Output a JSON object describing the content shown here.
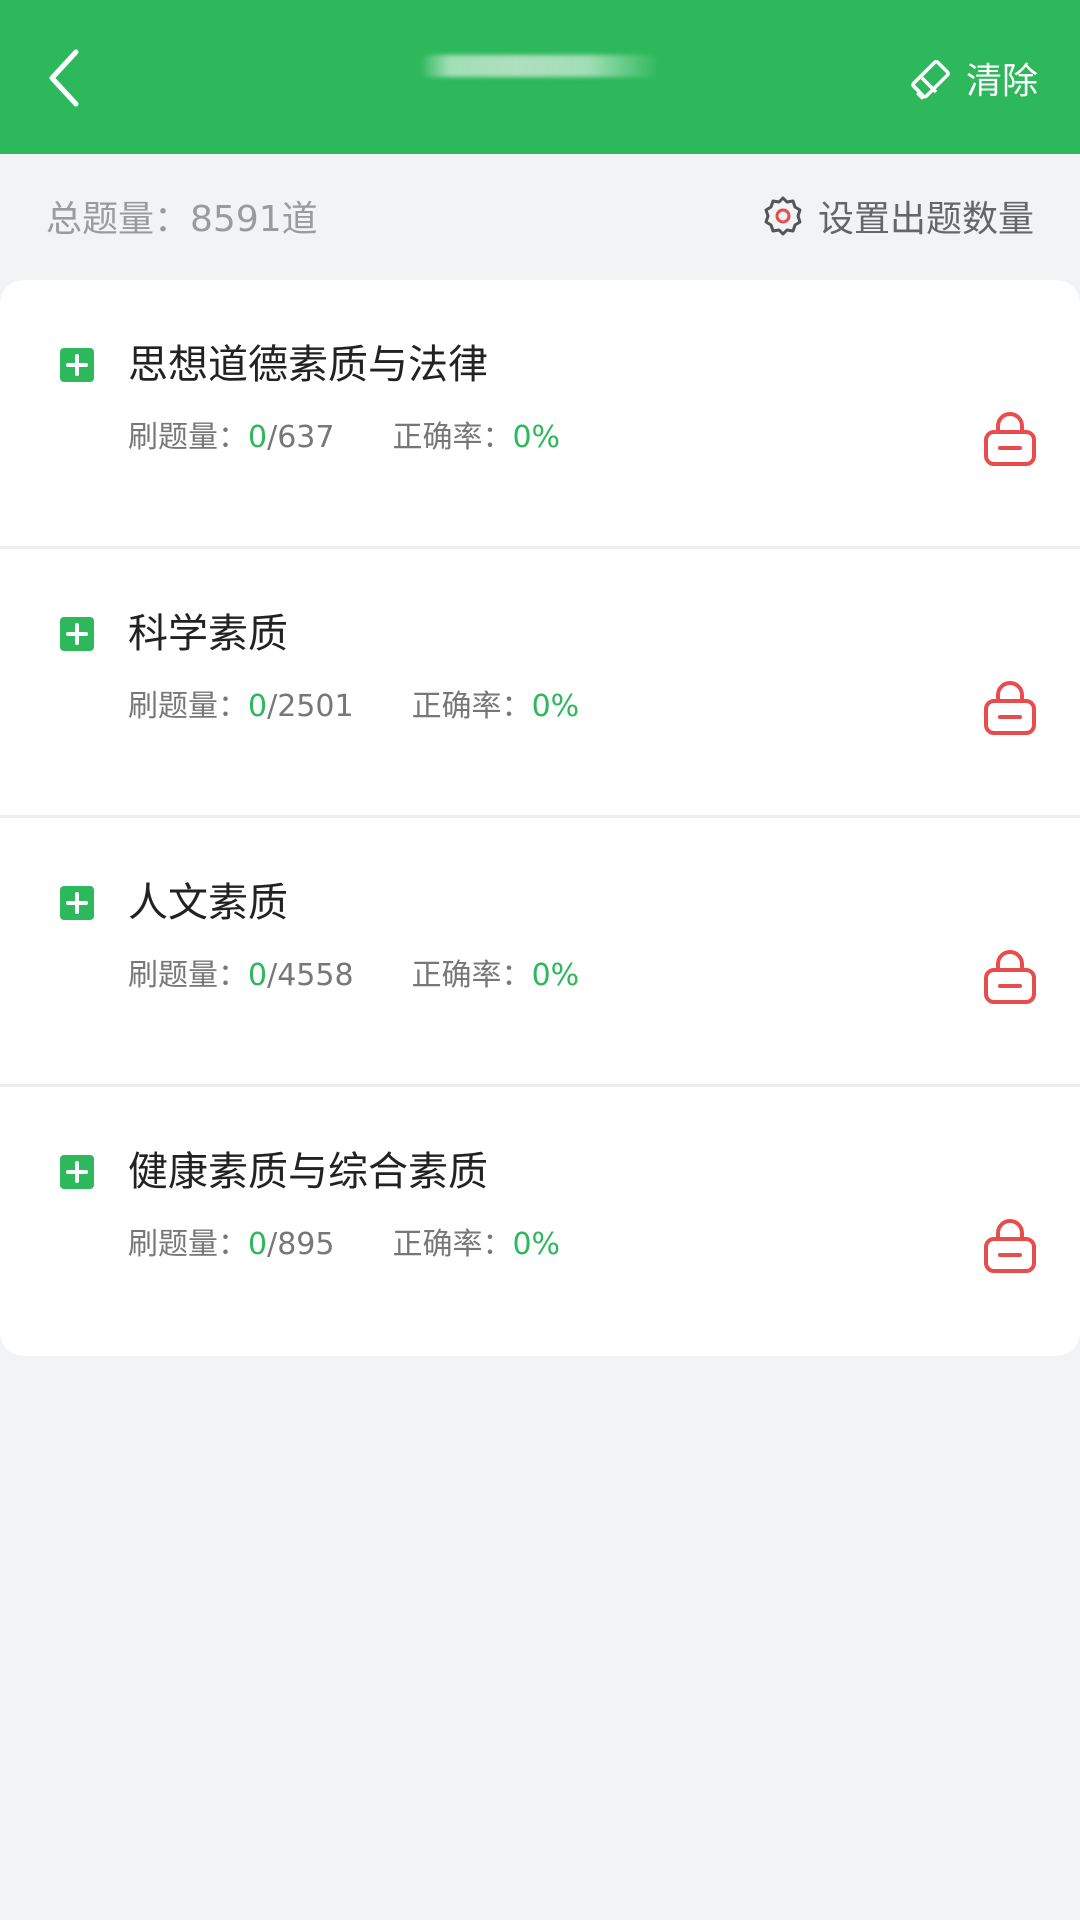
{
  "header": {
    "clear_label": "清除"
  },
  "summary": {
    "total_label": "总题量：",
    "total_value": "8591道",
    "set_count_label": "设置出题数量"
  },
  "subjects": [
    {
      "title": "思想道德素质与法律",
      "practice_label": "刷题量：",
      "done": "0",
      "total": "/637",
      "accuracy_label": "正确率：",
      "accuracy": "0%"
    },
    {
      "title": "科学素质",
      "practice_label": "刷题量：",
      "done": "0",
      "total": "/2501",
      "accuracy_label": "正确率：",
      "accuracy": "0%"
    },
    {
      "title": "人文素质",
      "practice_label": "刷题量：",
      "done": "0",
      "total": "/4558",
      "accuracy_label": "正确率：",
      "accuracy": "0%"
    },
    {
      "title": "健康素质与综合素质",
      "practice_label": "刷题量：",
      "done": "0",
      "total": "/895",
      "accuracy_label": "正确率：",
      "accuracy": "0%"
    }
  ],
  "colors": {
    "brand_green": "#2eb85c",
    "lock_red": "#e84c4c",
    "background": "#f2f3f5"
  },
  "icons": {
    "back": "chevron-left-icon",
    "clear": "eraser-icon",
    "settings": "gear-icon",
    "expand": "plus-square-icon",
    "lock": "lock-icon"
  }
}
